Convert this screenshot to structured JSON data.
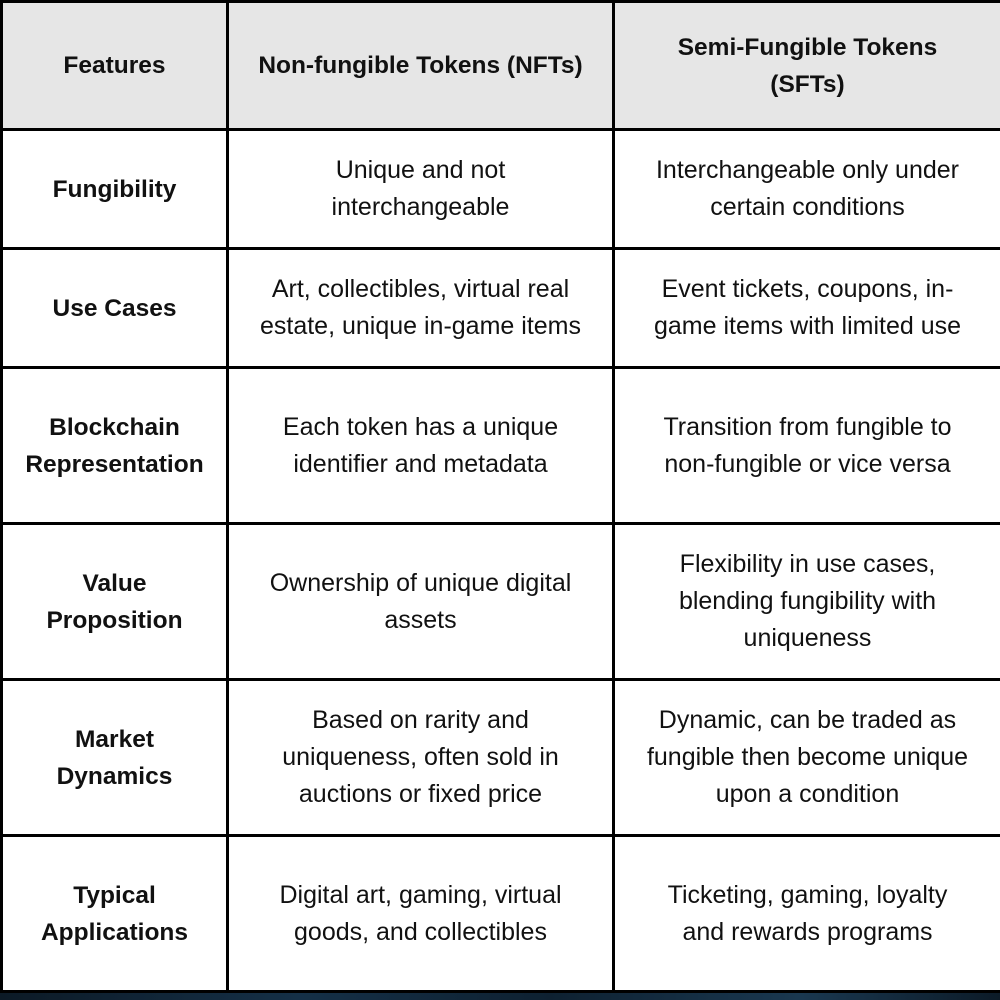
{
  "table": {
    "headers": [
      [
        "Features"
      ],
      [
        "Non-fungible Tokens (NFTs)"
      ],
      [
        "Semi-Fungible Tokens",
        "(SFTs)"
      ]
    ],
    "rows": [
      {
        "feature": [
          "Fungibility"
        ],
        "nft": [
          "Unique and not",
          "interchangeable"
        ],
        "sft": [
          "Interchangeable only under",
          "certain conditions"
        ]
      },
      {
        "feature": [
          "Use Cases"
        ],
        "nft": [
          "Art, collectibles, virtual real",
          "estate, unique in-game items"
        ],
        "sft": [
          "Event tickets, coupons, in-",
          "game items with limited use"
        ]
      },
      {
        "feature": [
          "Blockchain",
          "Representation"
        ],
        "nft": [
          "Each token has a unique",
          "identifier and metadata"
        ],
        "sft": [
          "Transition from fungible to",
          "non-fungible or vice versa"
        ]
      },
      {
        "feature": [
          "Value",
          "Proposition"
        ],
        "nft": [
          "Ownership of unique digital",
          "assets"
        ],
        "sft": [
          "Flexibility in use cases,",
          "blending fungibility with",
          "uniqueness"
        ]
      },
      {
        "feature": [
          "Market",
          "Dynamics"
        ],
        "nft": [
          "Based on rarity and",
          "uniqueness, often sold in",
          "auctions or fixed price"
        ],
        "sft": [
          "Dynamic, can be traded as",
          "fungible then become unique",
          "upon a condition"
        ]
      },
      {
        "feature": [
          "Typical",
          "Applications"
        ],
        "nft": [
          "Digital art, gaming, virtual",
          "goods, and collectibles"
        ],
        "sft": [
          "Ticketing, gaming, loyalty",
          "and rewards programs"
        ]
      }
    ]
  },
  "colors": {
    "header_bg": "#e6e6e6",
    "cell_bg": "#ffffff",
    "border": "#000000",
    "backdrop": "#0f2233"
  }
}
